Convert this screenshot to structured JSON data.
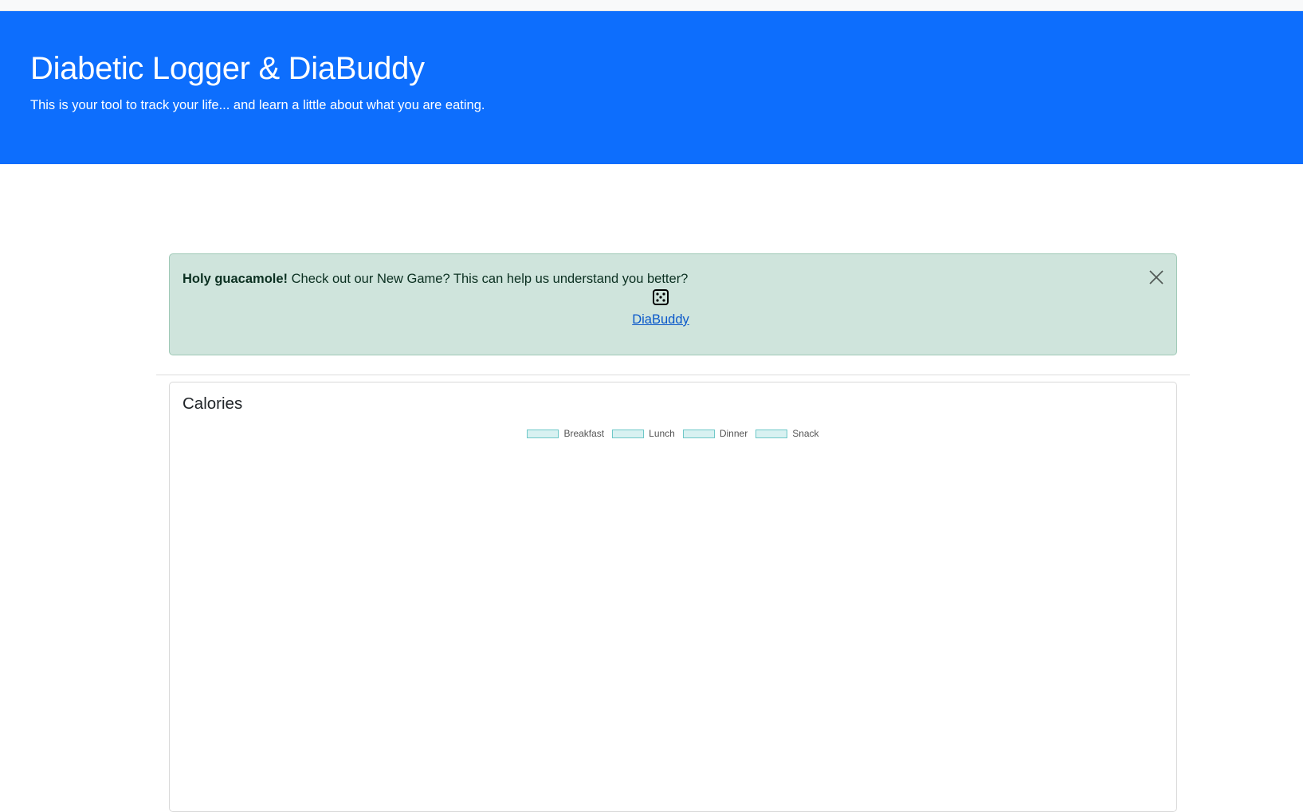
{
  "header": {
    "title": "Diabetic Logger & DiaBuddy",
    "subtitle": "This is your tool to track your life... and learn a little about what you are eating."
  },
  "alert": {
    "strong_text": "Holy guacamole!",
    "message": " Check out our New Game? This can help us understand you better?",
    "icon": "dice-five-icon",
    "link_label": "DiaBuddy",
    "close_icon": "close-icon"
  },
  "calories_card": {
    "title": "Calories"
  },
  "chart_data": {
    "type": "bar",
    "title": "",
    "categories": [],
    "series": [
      {
        "name": "Breakfast",
        "values": []
      },
      {
        "name": "Lunch",
        "values": []
      },
      {
        "name": "Dinner",
        "values": []
      },
      {
        "name": "Snack",
        "values": []
      }
    ],
    "legend": "top-center",
    "series_color": "#d8f1f1",
    "series_border_color": "#6ec8c8"
  },
  "colors": {
    "hero_background": "#0d6efd",
    "alert_background": "#cfe4dc",
    "link": "#0a58ca"
  }
}
